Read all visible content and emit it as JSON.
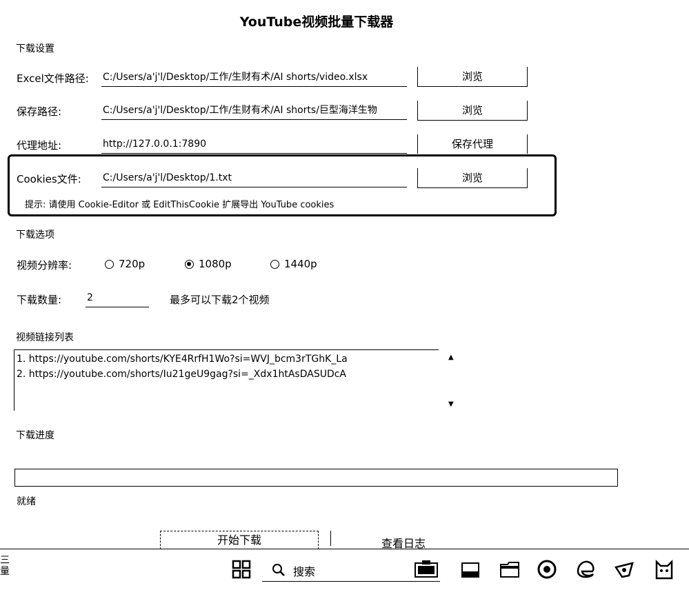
{
  "window": {
    "title": "YouTube视频批量下载器"
  },
  "settings": {
    "section_title": "下载设置",
    "excel": {
      "label": "Excel文件路径:",
      "value": "C:/Users/a'j'l/Desktop/工作/生财有术/AI shorts/video.xlsx",
      "button": "浏览"
    },
    "save": {
      "label": "保存路径:",
      "value": "C:/Users/a'j'l/Desktop/工作/生财有术/AI shorts/巨型海洋生物",
      "button": "浏览"
    },
    "proxy": {
      "label": "代理地址:",
      "value": "http://127.0.0.1:7890",
      "button": "保存代理"
    },
    "cookies": {
      "label": "Cookies文件:",
      "value": "C:/Users/a'j'l/Desktop/1.txt",
      "button": "浏览",
      "hint": "提示: 请使用 Cookie-Editor 或 EditThisCookie 扩展导出 YouTube cookies"
    }
  },
  "options": {
    "section_title": "下载选项",
    "resolution": {
      "label": "视频分辨率:",
      "choices": [
        {
          "label": "720p",
          "selected": false
        },
        {
          "label": "1080p",
          "selected": true
        },
        {
          "label": "1440p",
          "selected": false
        }
      ]
    },
    "count": {
      "label": "下载数量:",
      "value": "2",
      "note": "最多可以下载2个视频"
    }
  },
  "links": {
    "section_title": "视频链接列表",
    "items": [
      "1. https://youtube.com/shorts/KYE4RrfH1Wo?si=WVJ_bcm3rTGhK_La",
      "2. https://youtube.com/shorts/Iu21geU9gag?si=_Xdx1htAsDASUDcA"
    ]
  },
  "progress": {
    "section_title": "下载进度",
    "value": 0,
    "status": "就绪"
  },
  "actions": {
    "start": "开始下载",
    "log": "查看日志"
  },
  "taskbar": {
    "left_text": "三\n量",
    "search_label": "搜索"
  }
}
